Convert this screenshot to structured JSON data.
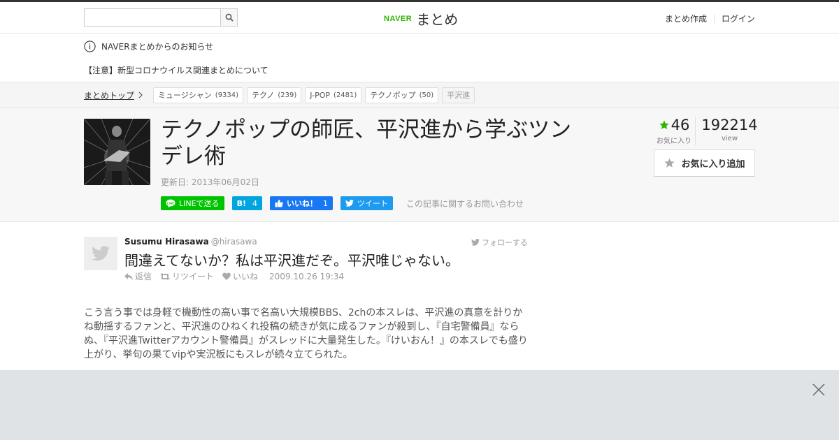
{
  "header": {
    "search_placeholder": "",
    "logo_brand": "NAVER",
    "logo_name": "まとめ",
    "links": [
      "まとめ作成",
      "ログイン"
    ]
  },
  "notice": {
    "title": "NAVERまとめからのお知らせ",
    "item": "【注意】新型コロナウイルス関連まとめについて"
  },
  "breadcrumb": {
    "top": "まとめトップ",
    "tags": [
      {
        "label": "ミュージシャン",
        "count": "(9334)"
      },
      {
        "label": "テクノ",
        "count": "(239)"
      },
      {
        "label": "J-POP",
        "count": "(2481)"
      },
      {
        "label": "テクノポップ",
        "count": "(50)"
      },
      {
        "label": "平沢進",
        "count": ""
      }
    ]
  },
  "article": {
    "title": "テクノポップの師匠、平沢進から学ぶツンデレ術",
    "updated": "更新日: 2013年06月02日",
    "share": {
      "line": "LINEで送る",
      "hatena_logo": "B!",
      "hatena_count": "4",
      "fb_label": "いいね！",
      "fb_count": "1",
      "tweet": "ツイート",
      "contact": "この記事に関するお問い合わせ"
    },
    "stats": {
      "fav_count": "46",
      "fav_label": "お気に入り",
      "view_count": "192214",
      "view_label": "view"
    },
    "fav_button": "お気に入り追加"
  },
  "tweet": {
    "name": "Susumu Hirasawa",
    "handle": "@hirasawa",
    "follow": "フォローする",
    "text": "間違えてないか？私は平沢進だぞ。平沢唯じゃない。",
    "reply": "返信",
    "retweet": "リツイート",
    "like": "いいね",
    "date": "2009.10.26 19:34"
  },
  "body": {
    "paragraph": "こう言う事では身軽で機動性の高い事で名高い大規模BBS、2chの本スレは、平沢進の真意を計りかね動揺するファンと、平沢進のひねくれ投稿の続きが気に成るファンが殺到し、『自宅警備員』ならぬ、『平沢進Twitterアカウント警備員』がスレッドに大量発生した。『けいおん！』の本スレでも盛り上がり、挙句の果てvipや実況板にもスレが続々立てられた。"
  },
  "colors": {
    "naver_green": "#2db400",
    "star_green": "#2db400",
    "line_green": "#00c300",
    "hatena_blue": "#00a4de",
    "facebook_blue": "#1877f2",
    "twitter_blue": "#1d9bf0"
  }
}
